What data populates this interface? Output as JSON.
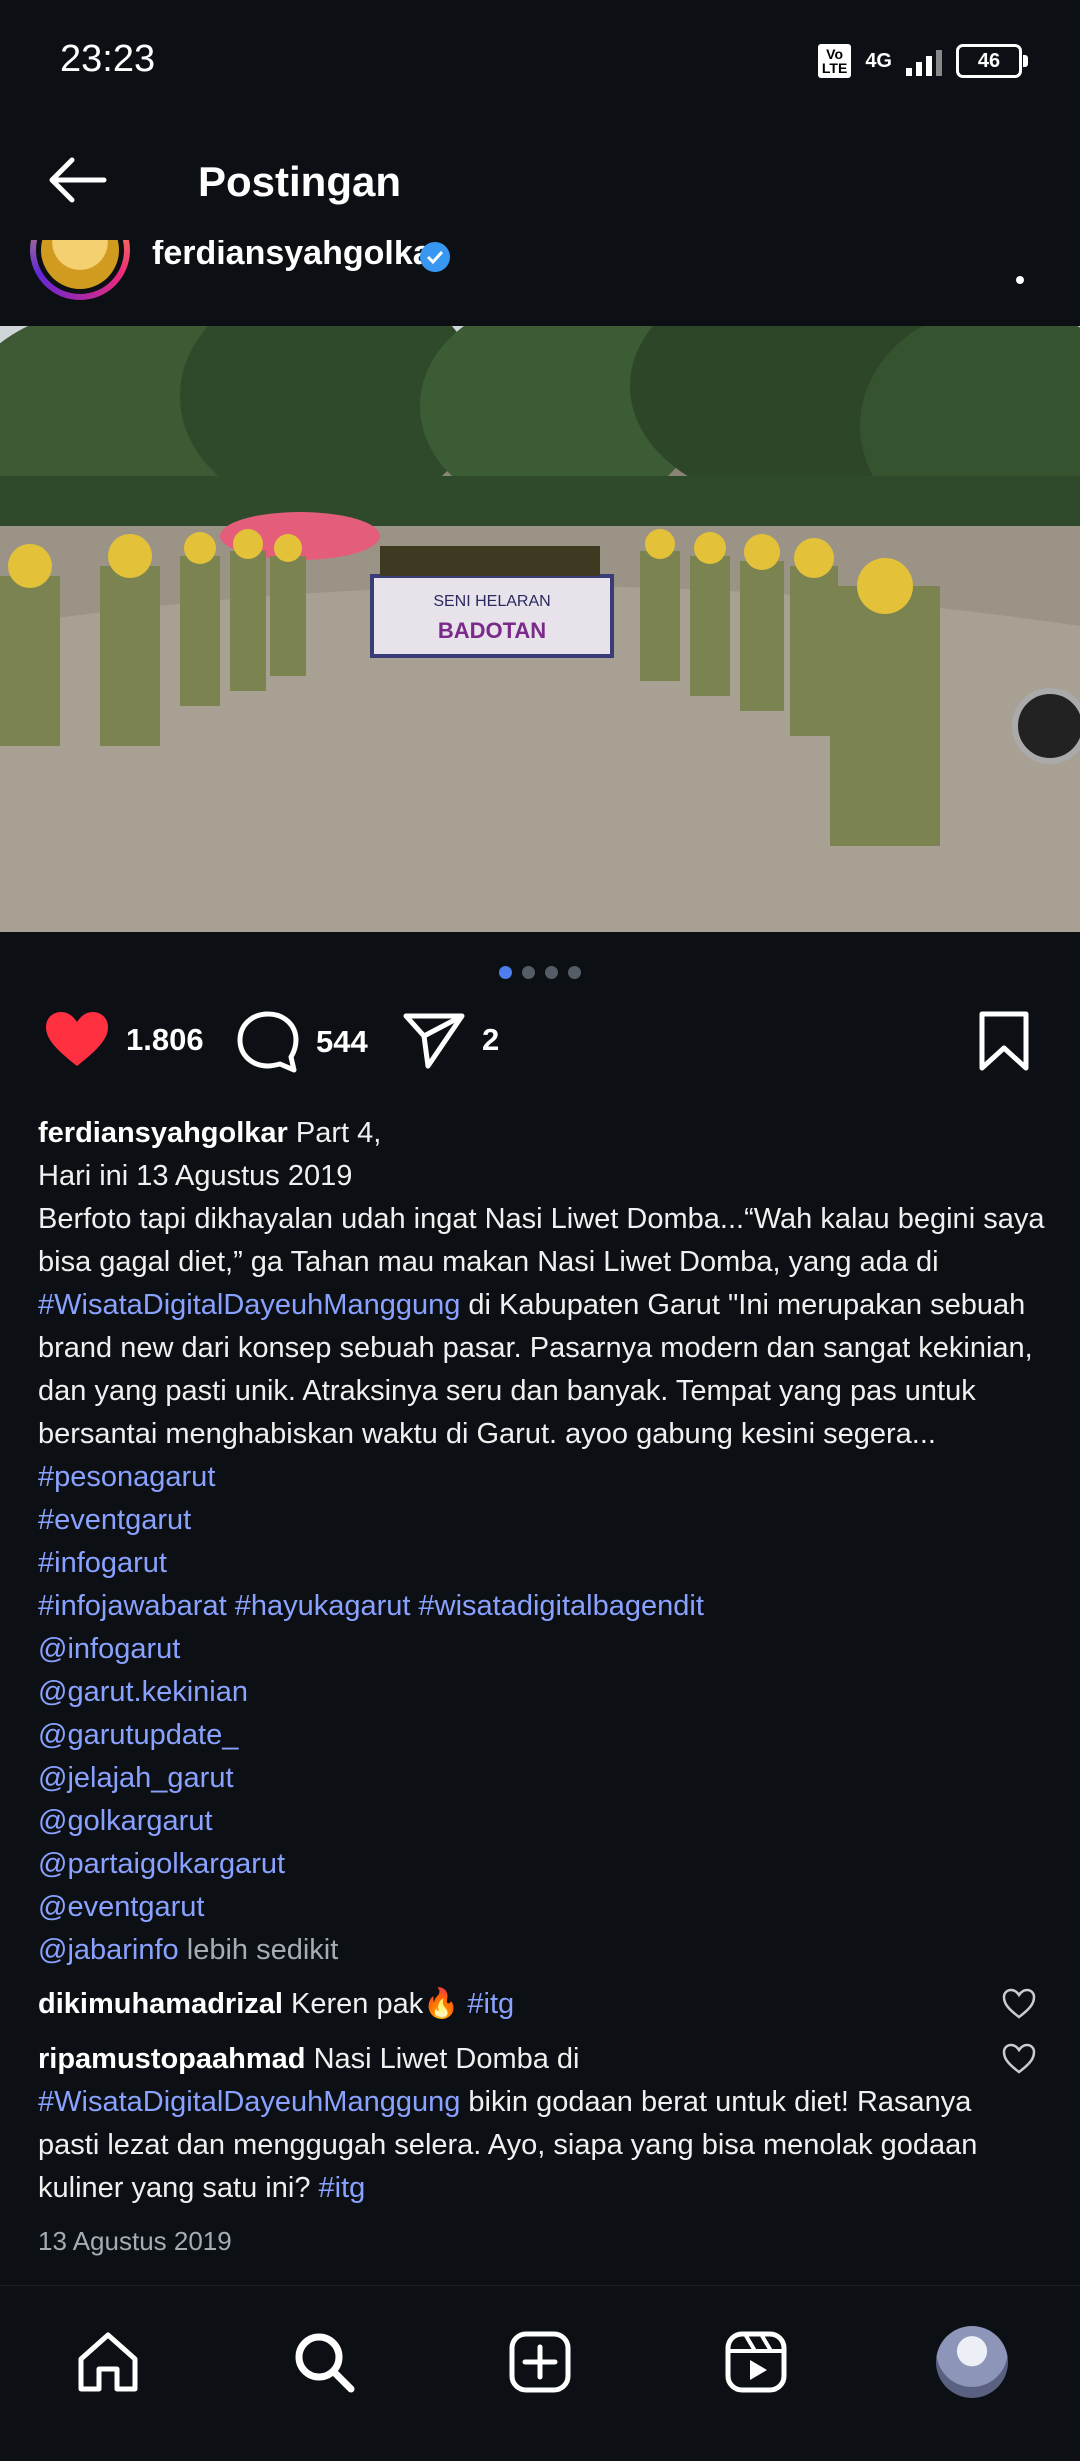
{
  "status_bar": {
    "time": "23:23",
    "volte": "Vo LTE",
    "network": "4G",
    "battery": "46"
  },
  "header": {
    "title": "Postingan"
  },
  "post": {
    "username": "ferdiansyahgolkar",
    "image_dots": 4,
    "active_dot": 0,
    "banner_text": "SENI HELARAN",
    "banner_sub": "BADOTAN",
    "likes": "1.806",
    "comments": "544",
    "shares": "2"
  },
  "caption": {
    "username": "ferdiansyahgolkar",
    "part": "Part 4,",
    "date_line": "Hari ini 13 Agustus 2019",
    "text1": "Berfoto tapi dikhayalan udah ingat Nasi Liwet Domba...“Wah kalau begini saya bisa gagal diet,” ga Tahan mau makan Nasi Liwet Domba, yang ada di ",
    "tag1": "#WisataDigitalDayeuhManggung",
    "text2": " di Kabupaten Garut \"Ini merupakan sebuah brand new dari konsep sebuah pasar. Pasarnya modern dan sangat kekinian, dan yang pasti unik. Atraksinya seru dan banyak. Tempat yang pas untuk bersantai menghabiskan waktu di Garut. ayoo gabung kesini segera... ",
    "tag2": "#pesonagarut",
    "tag3": "#eventgarut",
    "tag4": "#infogarut",
    "tag5": "#infojawabarat",
    "tag6": "#hayukagarut",
    "tag7": "#wisatadigitalbagendit",
    "mention1": "@infogarut",
    "mention2": "@garut.kekinian",
    "mention3": "@garutupdate_",
    "mention4": "@jelajah_garut",
    "mention5": "@golkargarut",
    "mention6": "@partaigolkargarut",
    "mention7": "@eventgarut",
    "mention8": "@jabarinfo",
    "less": "lebih sedikit"
  },
  "comments": [
    {
      "username": "dikimuhamadrizal",
      "text": "Keren pak🔥 ",
      "tag": "#itg"
    },
    {
      "username": "ripamustopaahmad",
      "text_a": "Nasi Liwet Domba di ",
      "tag_a": "#WisataDigitalDayeuhManggung",
      "text_b": " bikin godaan berat untuk diet! Rasanya pasti lezat dan menggugah selera. Ayo, siapa yang bisa menolak godaan kuliner yang satu ini? ",
      "tag_b": "#itg"
    }
  ],
  "post_date": "13 Agustus 2019",
  "nav": [
    "home-icon",
    "search-icon",
    "create-icon",
    "reels-icon",
    "profile-avatar"
  ],
  "colors": {
    "background": "#0c0f14",
    "link": "#8aa2ff",
    "like_red": "#ff3040",
    "dot_active": "#4e7df0"
  }
}
